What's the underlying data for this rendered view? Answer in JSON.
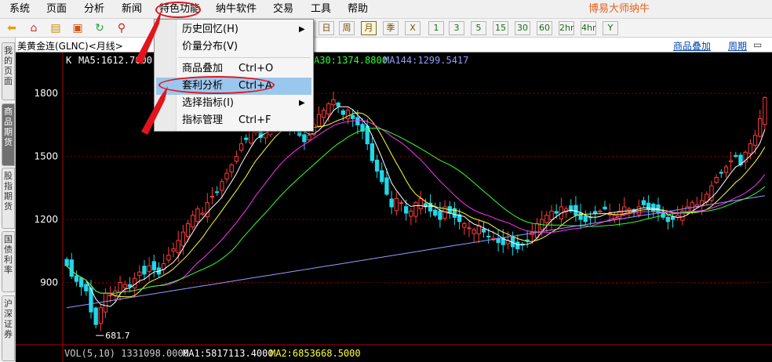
{
  "menubar": {
    "items": [
      "系统",
      "页面",
      "分析",
      "新闻",
      "特色功能",
      "纳牛软件",
      "交易",
      "工具",
      "帮助"
    ],
    "brand": "博易大师纳牛"
  },
  "toolbar": {
    "icons": [
      "back-arrow-icon",
      "home-icon",
      "notebook-icon",
      "monitor-icon",
      "refresh-icon",
      "zoom-icon"
    ],
    "periods": [
      "日",
      "周",
      "月",
      "季",
      "X",
      "1",
      "3",
      "5",
      "15",
      "30",
      "60",
      "2hr",
      "4hr",
      "Y"
    ],
    "active_period": "月"
  },
  "side_tabs": [
    "我的页面",
    "商品期货",
    "股指期货",
    "国债利率",
    "沪深证券"
  ],
  "chart_header": {
    "title": "美黄金连(GLNC)<月线>",
    "links": [
      "商品叠加",
      "周期"
    ],
    "window_buttons": "▭ ✕"
  },
  "indicators": {
    "main_label": "K",
    "ma5": "MA5:1612.7600",
    "ma30": "A30:1374.8800",
    "ma144": "MA144:1299.5417",
    "vol_line": "VOL(5,10) 1331098.0000",
    "ma1": "MA1:5817113.4000",
    "ma2": "MA2:6853668.5000"
  },
  "dropdown": {
    "items": [
      {
        "label": "历史回忆(H)",
        "shortcut": "",
        "submenu": true
      },
      {
        "label": "价量分布(V)",
        "shortcut": "",
        "submenu": false
      },
      {
        "label": "商品叠加",
        "shortcut": "Ctrl+O",
        "submenu": false
      },
      {
        "label": "套利分析",
        "shortcut": "Ctrl+A",
        "submenu": false
      },
      {
        "label": "选择指标(I)",
        "shortcut": "",
        "submenu": true
      },
      {
        "label": "指标管理",
        "shortcut": "Ctrl+F",
        "submenu": false
      }
    ],
    "highlighted_index": 3
  },
  "colors": {
    "up": "#ff3b3b",
    "down": "#20d8e8",
    "ma5": "#ffffff",
    "ma10": "#ffff33",
    "ma20": "#ff33ff",
    "ma30": "#33ff33",
    "ma144": "#9999ff",
    "grid": "#7a0000",
    "annotation": "#e2141b"
  },
  "chart_data": {
    "type": "candlestick",
    "y_ticks": [
      900,
      1200,
      1500,
      1800
    ],
    "ylim": [
      600,
      1920
    ],
    "low_marker": "681.7",
    "close": [
      980,
      930,
      905,
      880,
      860,
      760,
      700,
      780,
      850,
      840,
      860,
      900,
      890,
      880,
      920,
      950,
      940,
      980,
      960,
      940,
      990,
      1030,
      1060,
      1100,
      1140,
      1180,
      1220,
      1250,
      1230,
      1280,
      1310,
      1330,
      1380,
      1420,
      1460,
      1500,
      1560,
      1580,
      1620,
      1640,
      1590,
      1620,
      1660,
      1700,
      1680,
      1660,
      1640,
      1620,
      1600,
      1570,
      1600,
      1650,
      1700,
      1720,
      1750,
      1770,
      1740,
      1700,
      1720,
      1680,
      1650,
      1620,
      1560,
      1480,
      1430,
      1380,
      1320,
      1260,
      1300,
      1280,
      1230,
      1240,
      1280,
      1300,
      1260,
      1240,
      1220,
      1200,
      1260,
      1230,
      1210,
      1190,
      1180,
      1160,
      1150,
      1170,
      1140,
      1120,
      1110,
      1090,
      1080,
      1100,
      1070,
      1060,
      1080,
      1100,
      1140,
      1180,
      1200,
      1220,
      1240,
      1230,
      1260,
      1250,
      1240,
      1220,
      1200,
      1190,
      1210,
      1230,
      1240,
      1250,
      1230,
      1220,
      1240,
      1260,
      1250,
      1240,
      1260,
      1270,
      1250,
      1240,
      1230,
      1210,
      1190,
      1200,
      1220,
      1240,
      1260,
      1280,
      1270,
      1290,
      1320,
      1360,
      1400,
      1420,
      1450,
      1480,
      1500,
      1460,
      1520,
      1560,
      1600,
      1680,
      1780
    ]
  }
}
